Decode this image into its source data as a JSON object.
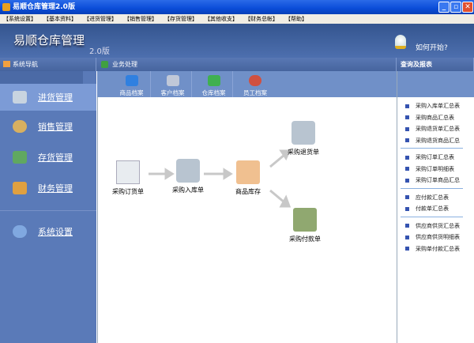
{
  "window": {
    "title": "易顺仓库管理2.0版"
  },
  "menu": [
    "【系统设置】",
    "【基本资料】",
    "【进货管理】",
    "【销售管理】",
    "【存货管理】",
    "【其他收支】",
    "【财务总帐】",
    "【帮助】"
  ],
  "banner": {
    "title": "易顺仓库管理",
    "version": "2.0版",
    "help": "如何开始?"
  },
  "headers": {
    "nav": "系统导航",
    "business": "业务处理",
    "reports": "查询及报表"
  },
  "nav": [
    {
      "label": "进货管理",
      "active": true
    },
    {
      "label": "销售管理"
    },
    {
      "label": "存货管理"
    },
    {
      "label": "财务管理"
    },
    {
      "label": "系统设置"
    }
  ],
  "toolbar": [
    "商品档案",
    "客户档案",
    "仓库档案",
    "员工档案"
  ],
  "flow": {
    "order": "采购订货单",
    "inbound": "采购入库单",
    "stock": "商品库存",
    "return": "采购退货单",
    "payment": "采购付款单"
  },
  "reports": [
    [
      "采购入库单汇总表",
      "采购商品汇总表",
      "采购退货单汇总表",
      "采购退货商品汇总"
    ],
    [
      "采购订单汇总表",
      "采购订单明细表",
      "采购订单商品汇总"
    ],
    [
      "应付款汇总表",
      "付款单汇总表"
    ],
    [
      "供应商供货汇总表",
      "供应商供货明细表",
      "采购单付款汇总表"
    ]
  ]
}
